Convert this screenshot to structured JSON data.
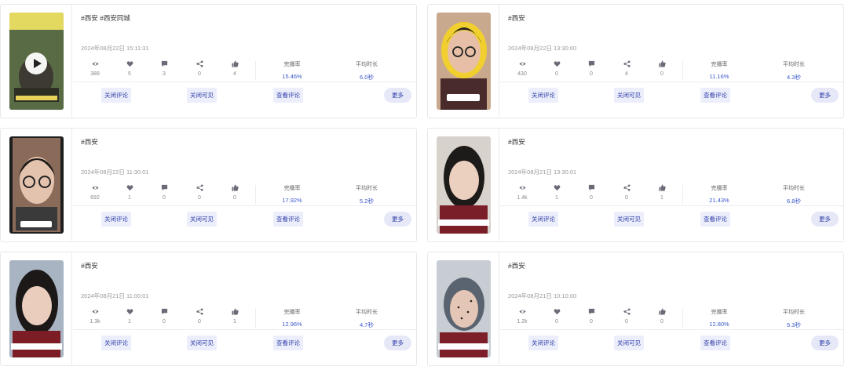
{
  "common": {
    "stat_icons": [
      "eye-icon",
      "heart-icon",
      "comment-icon",
      "share-icon",
      "thumbs-up-icon"
    ],
    "label_completion": "完播率",
    "label_avg_duration": "平均时长",
    "btn_close_comments": "关闭评论",
    "btn_close_visible": "关闭可见",
    "btn_view_comments": "查看评论",
    "btn_more": "更多"
  },
  "colors": {
    "accent": "#3a58c9",
    "button_bg": "#eceefb"
  },
  "videos": [
    {
      "tags": "#西安 #西安同城",
      "time": "2024年08月22日 15:11:31",
      "views": "388",
      "likes": "5",
      "comments": "3",
      "shares": "0",
      "thumbs": "4",
      "completion": "15.46%",
      "avg_duration": "6.0秒",
      "thumb_caption": "西安又大额土单插踏点"
    },
    {
      "tags": "#西安",
      "time": "2024年08月22日 13:30:00",
      "views": "430",
      "likes": "0",
      "comments": "0",
      "shares": "4",
      "thumbs": "0",
      "completion": "11.16%",
      "avg_duration": "4.3秒",
      "thumb_caption": "学子学必知"
    },
    {
      "tags": "#西安",
      "time": "2024年08月22日 11:30:01",
      "views": "692",
      "likes": "1",
      "comments": "0",
      "shares": "0",
      "thumbs": "0",
      "completion": "17.92%",
      "avg_duration": "5.2秒",
      "thumb_caption": "我来了"
    },
    {
      "tags": "#西安",
      "time": "2024年08月21日 13:30:01",
      "views": "1.4k",
      "likes": "1",
      "comments": "0",
      "shares": "0",
      "thumbs": "1",
      "completion": "21.43%",
      "avg_duration": "6.8秒",
      "thumb_caption": "我是你学姐你来啦"
    },
    {
      "tags": "#西安",
      "time": "2024年08月21日 11:00:01",
      "views": "1.3k",
      "likes": "1",
      "comments": "0",
      "shares": "0",
      "thumbs": "1",
      "completion": "12.96%",
      "avg_duration": "4.7秒",
      "thumb_caption": "我是你学姐你来啦"
    },
    {
      "tags": "#西安",
      "time": "2024年08月21日 10:10:00",
      "views": "1.2k",
      "likes": "0",
      "comments": "0",
      "shares": "0",
      "thumbs": "0",
      "completion": "12.80%",
      "avg_duration": "5.3秒",
      "thumb_caption": "我是你学姐你来啦"
    }
  ]
}
